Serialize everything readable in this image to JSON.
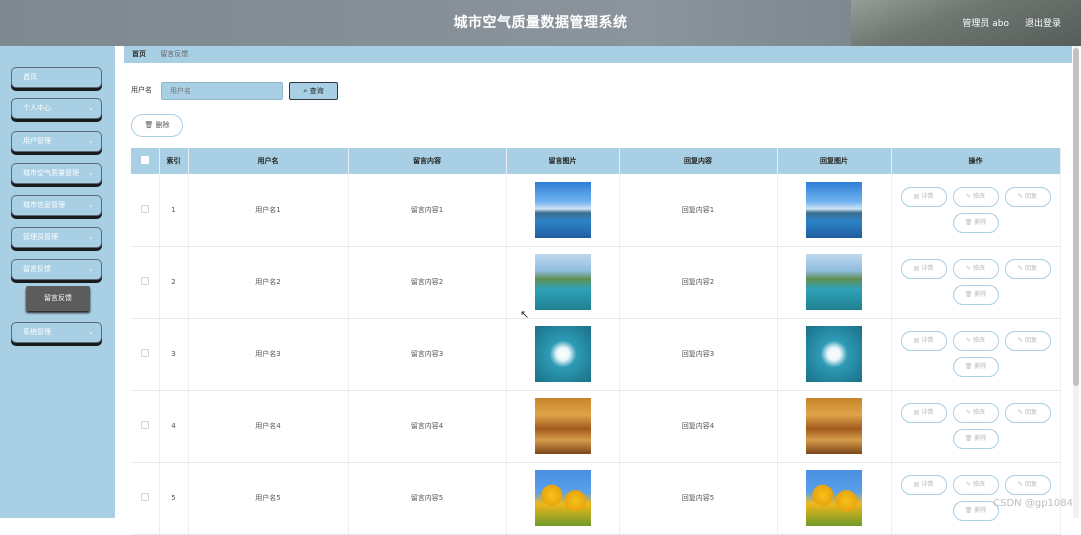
{
  "header": {
    "title": "城市空气质量数据管理系统",
    "user": "管理员 abo",
    "logout": "退出登录"
  },
  "sidebar": {
    "items": [
      {
        "label": "首页",
        "has_chevron": false
      },
      {
        "label": "个人中心",
        "has_chevron": true
      },
      {
        "label": "用户管理",
        "has_chevron": true
      },
      {
        "label": "城市空气质量管理",
        "has_chevron": true
      },
      {
        "label": "城市信息管理",
        "has_chevron": true
      },
      {
        "label": "管理员管理",
        "has_chevron": true
      },
      {
        "label": "留言反馈",
        "has_chevron": true
      },
      {
        "label": "系统管理",
        "has_chevron": true
      }
    ],
    "active_submenu": "留言反馈"
  },
  "breadcrumb": {
    "home": "首页",
    "current": "留言反馈"
  },
  "search": {
    "label": "用户名",
    "placeholder": "用户名",
    "button_label": "查询"
  },
  "actions": {
    "delete_label": "删除"
  },
  "table": {
    "headers": [
      "",
      "索引",
      "用户名",
      "留言内容",
      "留言图片",
      "回复内容",
      "回复图片",
      "操作"
    ],
    "rows": [
      {
        "index": "1",
        "username": "用户名1",
        "content": "留言内容1",
        "image": "lake",
        "reply": "回复内容1",
        "reply_image": "lake"
      },
      {
        "index": "2",
        "username": "用户名2",
        "content": "留言内容2",
        "image": "gazebo",
        "reply": "回复内容2",
        "reply_image": "gazebo"
      },
      {
        "index": "3",
        "username": "用户名3",
        "content": "留言内容3",
        "image": "flower",
        "reply": "回复内容3",
        "reply_image": "flower"
      },
      {
        "index": "4",
        "username": "用户名4",
        "content": "留言内容4",
        "image": "autumn",
        "reply": "回复内容4",
        "reply_image": "autumn"
      },
      {
        "index": "5",
        "username": "用户名5",
        "content": "留言内容5",
        "image": "sunflower",
        "reply": "回复内容5",
        "reply_image": "sunflower"
      }
    ],
    "row_actions": [
      "详情",
      "修改",
      "回复",
      "删除"
    ]
  },
  "watermark": "CSDN @gp1084",
  "colors": {
    "accent": "#a8cfe3",
    "header_bg": "#878f96",
    "submenu_bg": "#5c5c5c"
  }
}
